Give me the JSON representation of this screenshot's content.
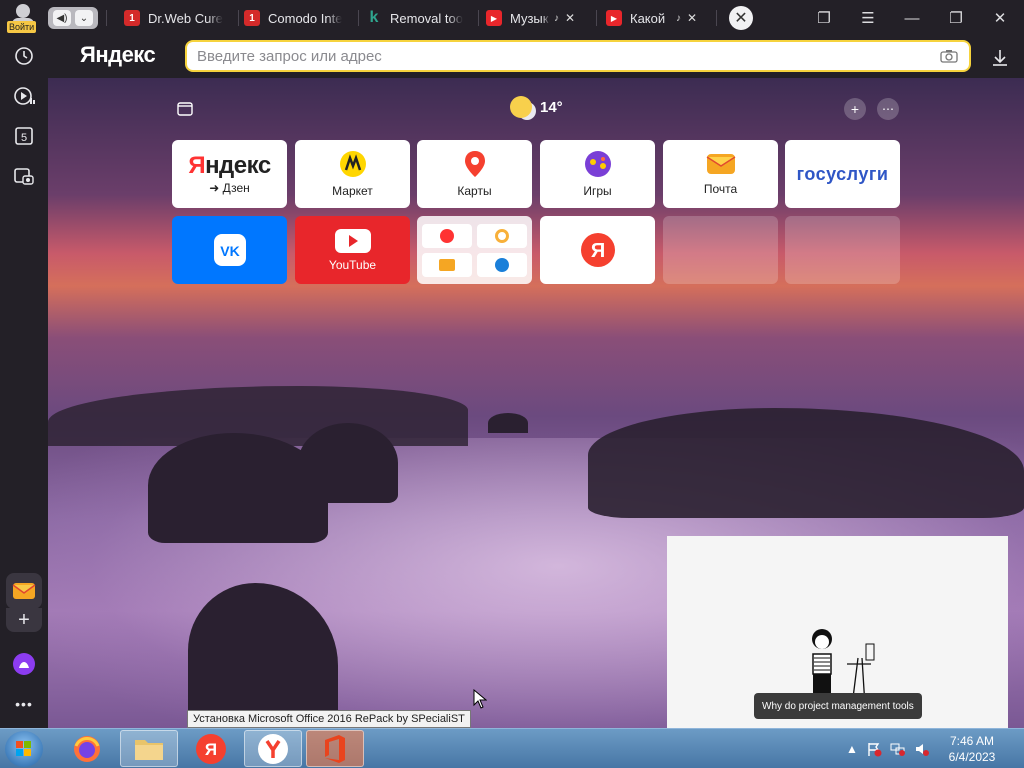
{
  "tabbar": {
    "login_label": "Войти",
    "tabs": [
      {
        "title": "Dr.Web Cure",
        "fav": "1",
        "fav_color": "#d42a2a",
        "sound": false
      },
      {
        "title": "Comodo Inte",
        "fav": "1",
        "fav_color": "#d42a2a",
        "sound": false
      },
      {
        "title": "Removal too",
        "fav": "k",
        "fav_color": "#2b2b2b",
        "sound": false
      },
      {
        "title": "Музыка",
        "fav": "▶",
        "fav_color": "#e8262b",
        "sound": true
      },
      {
        "title": "Какой",
        "fav": "▶",
        "fav_color": "#e8262b",
        "sound": true
      }
    ],
    "sound_icon": "♪",
    "close_icon": "✕"
  },
  "address": {
    "logo": "Яндекс",
    "placeholder": "Введите запрос или адрес"
  },
  "weather": {
    "temp": "14°"
  },
  "tiles_row1": [
    {
      "id": "yandex-dzen",
      "brand": "Яндекс",
      "label": "➜ Дзен"
    },
    {
      "id": "market",
      "label": "Маркет"
    },
    {
      "id": "maps",
      "label": "Карты"
    },
    {
      "id": "games",
      "label": "Игры"
    },
    {
      "id": "mail",
      "label": "Почта"
    },
    {
      "id": "gosuslugi",
      "brand": "госуслуги"
    }
  ],
  "tiles_row2": [
    {
      "id": "vk",
      "brand": "VK"
    },
    {
      "id": "youtube",
      "label": "YouTube"
    },
    {
      "id": "yandex",
      "brand": "Я"
    }
  ],
  "video": {
    "caption": "Why do project management tools"
  },
  "tooltip": "Установка Microsoft Office 2016 RePack by SPecialiST",
  "taskbar": {
    "time": "7:46 AM",
    "date": "6/4/2023"
  },
  "colors": {
    "accent": "#f6d33d",
    "chrome": "#232027",
    "youtube": "#e8262b",
    "vk": "#0077ff"
  }
}
